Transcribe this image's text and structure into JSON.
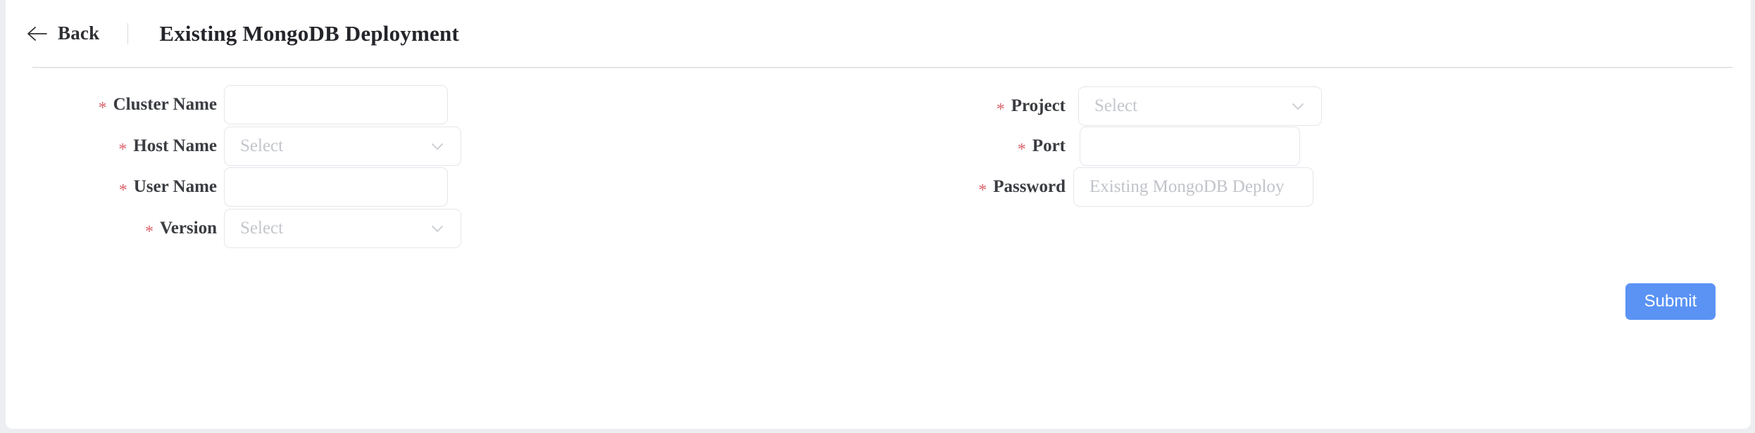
{
  "header": {
    "back_label": "Back",
    "back_icon": "arrow-left-icon",
    "title": "Existing MongoDB Deployment"
  },
  "form": {
    "left_fields": [
      {
        "label": "Cluster Name",
        "required_marker": "*",
        "type": "text",
        "value": "",
        "placeholder": ""
      },
      {
        "label": "Host Name",
        "required_marker": "*",
        "type": "select",
        "value": "",
        "placeholder": "Select",
        "icon": "chevron-down-icon"
      },
      {
        "label": "User Name",
        "required_marker": "*",
        "type": "text",
        "value": "",
        "placeholder": ""
      },
      {
        "label": "Version",
        "required_marker": "*",
        "type": "select",
        "value": "",
        "placeholder": "Select",
        "icon": "chevron-down-icon"
      }
    ],
    "right_fields": [
      {
        "label": "Project",
        "required_marker": "*",
        "type": "select",
        "value": "",
        "placeholder": "Select",
        "icon": "chevron-down-icon"
      },
      {
        "label": "Port",
        "required_marker": "*",
        "type": "text",
        "value": "",
        "placeholder": ""
      },
      {
        "label": "Password",
        "required_marker": "*",
        "type": "password",
        "value": "",
        "placeholder": "Existing MongoDB Deploy"
      }
    ]
  },
  "actions": {
    "submit_label": "Submit"
  },
  "colors": {
    "accent": "#5b93f5",
    "required_star": "#d9636b",
    "label_text": "#3a3c41",
    "placeholder_text": "#c0c3c9",
    "border": "#e4e6ea",
    "page_background": "#eceef1"
  }
}
